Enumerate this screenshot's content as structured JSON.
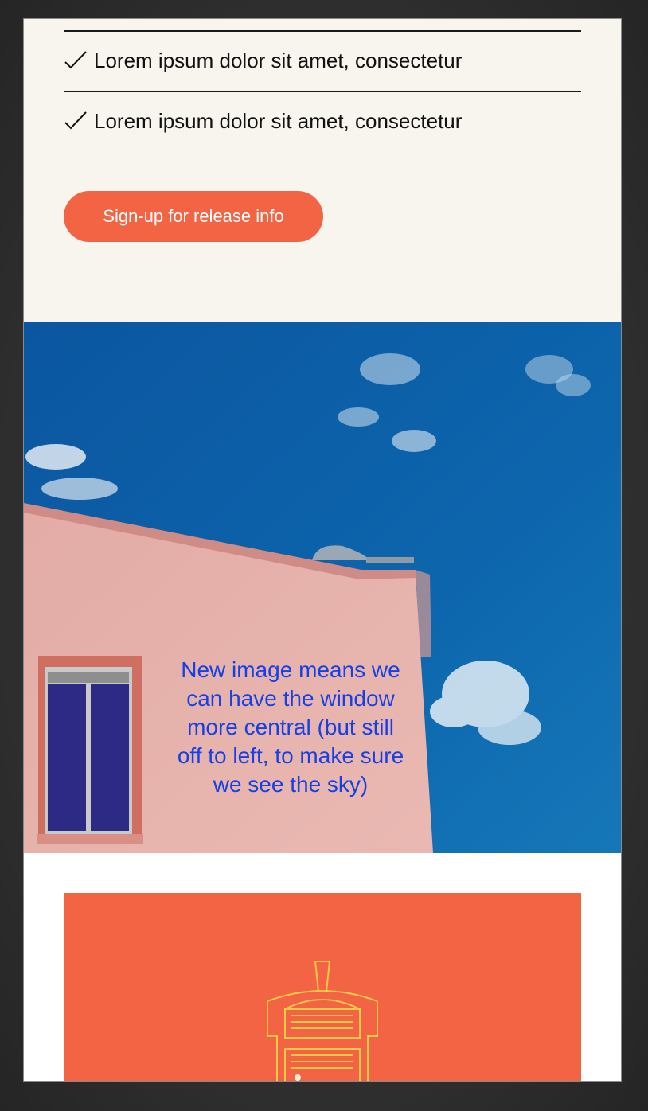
{
  "features": {
    "items": [
      {
        "text": "Lorem ipsum dolor sit amet, consectetur"
      },
      {
        "text": "Lorem ipsum dolor sit amet, consectetur"
      }
    ]
  },
  "cta": {
    "label": "Sign-up for release info"
  },
  "hero": {
    "annotation": "New image means we can have the window more central (but still off to left, to make sure we see the sky)"
  },
  "colors": {
    "accent": "#f26444",
    "cream_background": "#f8f5ef",
    "annotation_text": "#1640e6",
    "sky": "#0b63a9",
    "wall": "#e7b0ab",
    "icon_stroke": "#f7c948"
  },
  "icons": [
    "checkmark-icon",
    "building-illustration-icon"
  ]
}
